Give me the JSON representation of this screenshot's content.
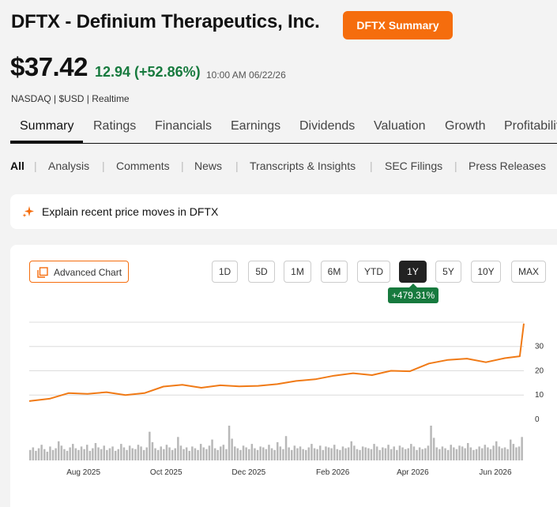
{
  "header": {
    "title": "DFTX - Definium Therapeutics, Inc.",
    "summary_button": "DFTX Summary",
    "price": "$37.42",
    "change": "12.94 (+52.86%)",
    "timestamp": "10:00 AM 06/22/26",
    "exchange_line": "NASDAQ | $USD | Realtime"
  },
  "tabs": [
    {
      "label": "Summary",
      "active": true
    },
    {
      "label": "Ratings"
    },
    {
      "label": "Financials"
    },
    {
      "label": "Earnings"
    },
    {
      "label": "Dividends"
    },
    {
      "label": "Valuation"
    },
    {
      "label": "Growth"
    },
    {
      "label": "Profitability"
    }
  ],
  "subtabs": [
    {
      "label": "All",
      "active": true
    },
    {
      "label": "Analysis"
    },
    {
      "label": "Comments"
    },
    {
      "label": "News"
    },
    {
      "label": "Transcripts & Insights"
    },
    {
      "label": "SEC Filings"
    },
    {
      "label": "Press Releases"
    }
  ],
  "explain": {
    "label": "Explain recent price moves in DFTX",
    "icon": "sparkle-icon"
  },
  "chart_controls": {
    "advanced_chart": "Advanced Chart",
    "ranges": [
      "1D",
      "5D",
      "1M",
      "6M",
      "YTD",
      "1Y",
      "5Y",
      "10Y",
      "MAX"
    ],
    "active_range": "1Y",
    "performance": "+479.31%"
  },
  "colors": {
    "accent": "#f56d0d",
    "positive": "#177a3e",
    "line": "#f07a16",
    "volume": "#b8b8b8"
  },
  "chart_data": {
    "type": "line",
    "title": "",
    "xlabel": "",
    "ylabel": "",
    "ylim": [
      -2,
      38
    ],
    "y_ticks": [
      "30",
      "20",
      "10",
      "0"
    ],
    "y_tick_values": [
      30,
      20,
      10,
      0
    ],
    "x_ticks": [
      "Aug 2025",
      "Oct 2025",
      "Dec 2025",
      "Feb 2026",
      "Apr 2026",
      "Jun 2026"
    ],
    "x_tick_dates": [
      "2025-08-01",
      "2025-10-01",
      "2025-12-01",
      "2026-02-01",
      "2026-04-01",
      "2026-06-01"
    ],
    "x_range": [
      "2025-06-22",
      "2026-06-22"
    ],
    "grid": true,
    "series": [
      {
        "x": [
          "2025-06-22",
          "2025-07-07",
          "2025-07-21",
          "2025-08-04",
          "2025-08-18",
          "2025-09-01",
          "2025-09-15",
          "2025-09-29",
          "2025-10-13",
          "2025-10-27",
          "2025-11-10",
          "2025-11-24",
          "2025-12-08",
          "2025-12-22",
          "2026-01-05",
          "2026-01-19",
          "2026-02-02",
          "2026-02-16",
          "2026-03-02",
          "2026-03-16",
          "2026-03-30",
          "2026-04-13",
          "2026-04-27",
          "2026-05-11",
          "2026-05-25",
          "2026-06-08",
          "2026-06-19",
          "2026-06-22"
        ],
        "values": [
          5.5,
          6.5,
          8.8,
          8.5,
          9.2,
          8.0,
          8.8,
          11.5,
          12.2,
          11.0,
          12.0,
          11.6,
          11.8,
          12.5,
          13.8,
          14.5,
          16.0,
          17.0,
          16.2,
          18.0,
          17.8,
          21.0,
          22.5,
          23.0,
          21.5,
          23.2,
          24.0,
          37.4
        ]
      }
    ],
    "volume": [
      12,
      15,
      11,
      14,
      18,
      13,
      10,
      16,
      12,
      14,
      22,
      17,
      13,
      11,
      15,
      19,
      14,
      12,
      16,
      13,
      18,
      11,
      14,
      20,
      15,
      13,
      17,
      12,
      14,
      16,
      11,
      13,
      19,
      15,
      12,
      17,
      14,
      13,
      18,
      16,
      12,
      15,
      33,
      21,
      14,
      12,
      16,
      13,
      18,
      15,
      12,
      14,
      27,
      17,
      13,
      15,
      11,
      16,
      14,
      12,
      19,
      15,
      13,
      17,
      24,
      14,
      12,
      16,
      18,
      13,
      40,
      25,
      16,
      14,
      12,
      17,
      15,
      13,
      19,
      14,
      12,
      16,
      15,
      13,
      18,
      14,
      12,
      21,
      16,
      13,
      28,
      15,
      12,
      17,
      14,
      16,
      13,
      12,
      15,
      19,
      14,
      13,
      17,
      12,
      16,
      15,
      14,
      18,
      13,
      12,
      16,
      14,
      15,
      22,
      17,
      13,
      12,
      16,
      15,
      14,
      13,
      19,
      16,
      12,
      15,
      14,
      18,
      13,
      16,
      12,
      17,
      15,
      13,
      14,
      19,
      16,
      12,
      15,
      13,
      14,
      17,
      40,
      26,
      15,
      13,
      16,
      14,
      12,
      18,
      15,
      13,
      17,
      16,
      14,
      20,
      15,
      12,
      13,
      16,
      14,
      18,
      15,
      13,
      17,
      22,
      16,
      14,
      15,
      13,
      24,
      19,
      15,
      16,
      27
    ]
  }
}
